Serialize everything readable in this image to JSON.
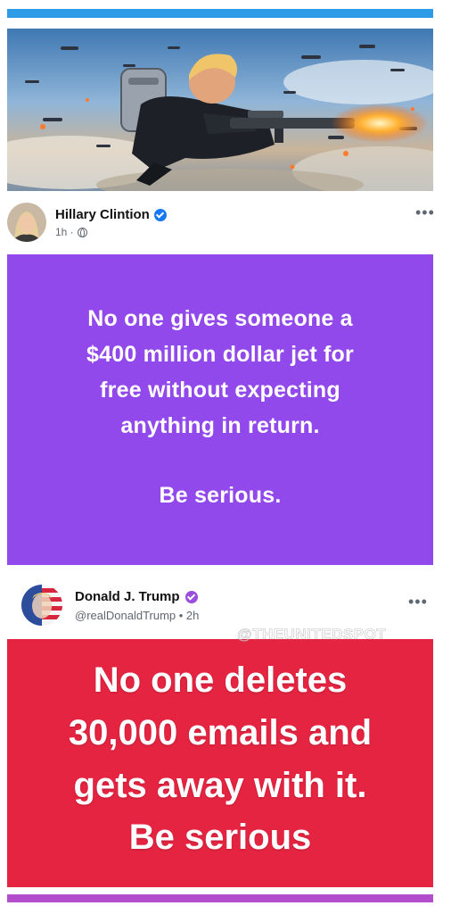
{
  "colors": {
    "top_strip": "#2e9be6",
    "purple_card": "#9249ec",
    "red_card": "#e52441",
    "bottom_strip": "#b24ecb",
    "verified_blue": "#1877f2",
    "verified_purple": "#9b4dde"
  },
  "image_post": {
    "icon": "illustration-soldier-flying-with-rifle"
  },
  "post_hc": {
    "author": "Hillary Clintion",
    "badge_icon": "verified-badge-icon",
    "time": "1h ·",
    "privacy_icon": "globe-icon",
    "more": "•••",
    "card_lines": [
      "No one gives someone a",
      "$400 million dollar jet for",
      "free without expecting",
      "anything in return.",
      "Be serious."
    ]
  },
  "post_dt": {
    "author": "Donald J. Trump",
    "badge_icon": "verified-badge-icon",
    "handle_time": "@realDonaldTrump • 2h",
    "more": "•••",
    "watermark": "@THEUNITEDSPOT",
    "card_lines": [
      "No one deletes",
      "30,000 emails and",
      "gets away with it.",
      "Be serious"
    ]
  }
}
